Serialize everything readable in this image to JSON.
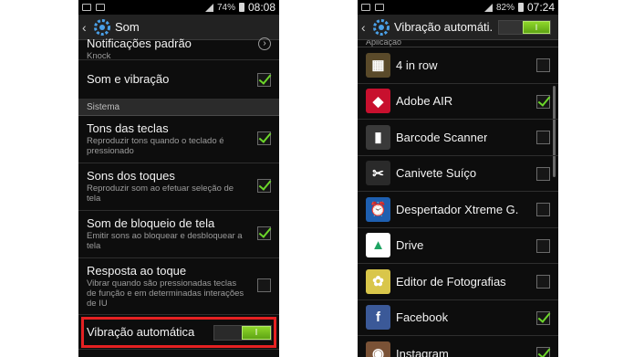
{
  "left": {
    "status": {
      "battery": "74%",
      "time": "08:08"
    },
    "title": "Som",
    "rows": [
      {
        "title": "Notificações padrão",
        "sub": "Knock"
      },
      {
        "title": "Som e vibração"
      }
    ],
    "section": "Sistema",
    "system_rows": [
      {
        "title": "Tons das teclas",
        "sub": "Reproduzir tons quando o teclado é pressionado"
      },
      {
        "title": "Sons dos toques",
        "sub": "Reproduzir som ao efetuar seleção de tela"
      },
      {
        "title": "Som de bloqueio de tela",
        "sub": "Emitir sons ao bloquear e desbloquear a tela"
      },
      {
        "title": "Resposta ao toque",
        "sub": "Vibrar quando são pressionadas teclas de função e em determinadas interações de IU"
      }
    ],
    "vibration": {
      "label": "Vibração automática",
      "toggle": "I"
    }
  },
  "right": {
    "status": {
      "battery": "82%",
      "time": "07:24"
    },
    "title": "Vibração automáti.",
    "toggle": "I",
    "section": "Aplicação",
    "apps": [
      {
        "name": "4 in row",
        "checked": false,
        "color": "#5a4a2a",
        "glyph": "▦"
      },
      {
        "name": "Adobe AIR",
        "checked": true,
        "color": "#c8102e",
        "glyph": "◆"
      },
      {
        "name": "Barcode Scanner",
        "checked": false,
        "color": "#3a3a3a",
        "glyph": "▮"
      },
      {
        "name": "Canivete Suíço",
        "checked": false,
        "color": "#2a2a2a",
        "glyph": "✂"
      },
      {
        "name": "Despertador Xtreme G.",
        "checked": false,
        "color": "#1e5fb0",
        "glyph": "⏰"
      },
      {
        "name": "Drive",
        "checked": false,
        "color": "#ffffff",
        "glyph": "▲"
      },
      {
        "name": "Editor de Fotografias",
        "checked": false,
        "color": "#d9c64a",
        "glyph": "✿"
      },
      {
        "name": "Facebook",
        "checked": true,
        "color": "#3b5998",
        "glyph": "f"
      },
      {
        "name": "Instagram",
        "checked": true,
        "color": "#7a5236",
        "glyph": "◉"
      }
    ]
  }
}
